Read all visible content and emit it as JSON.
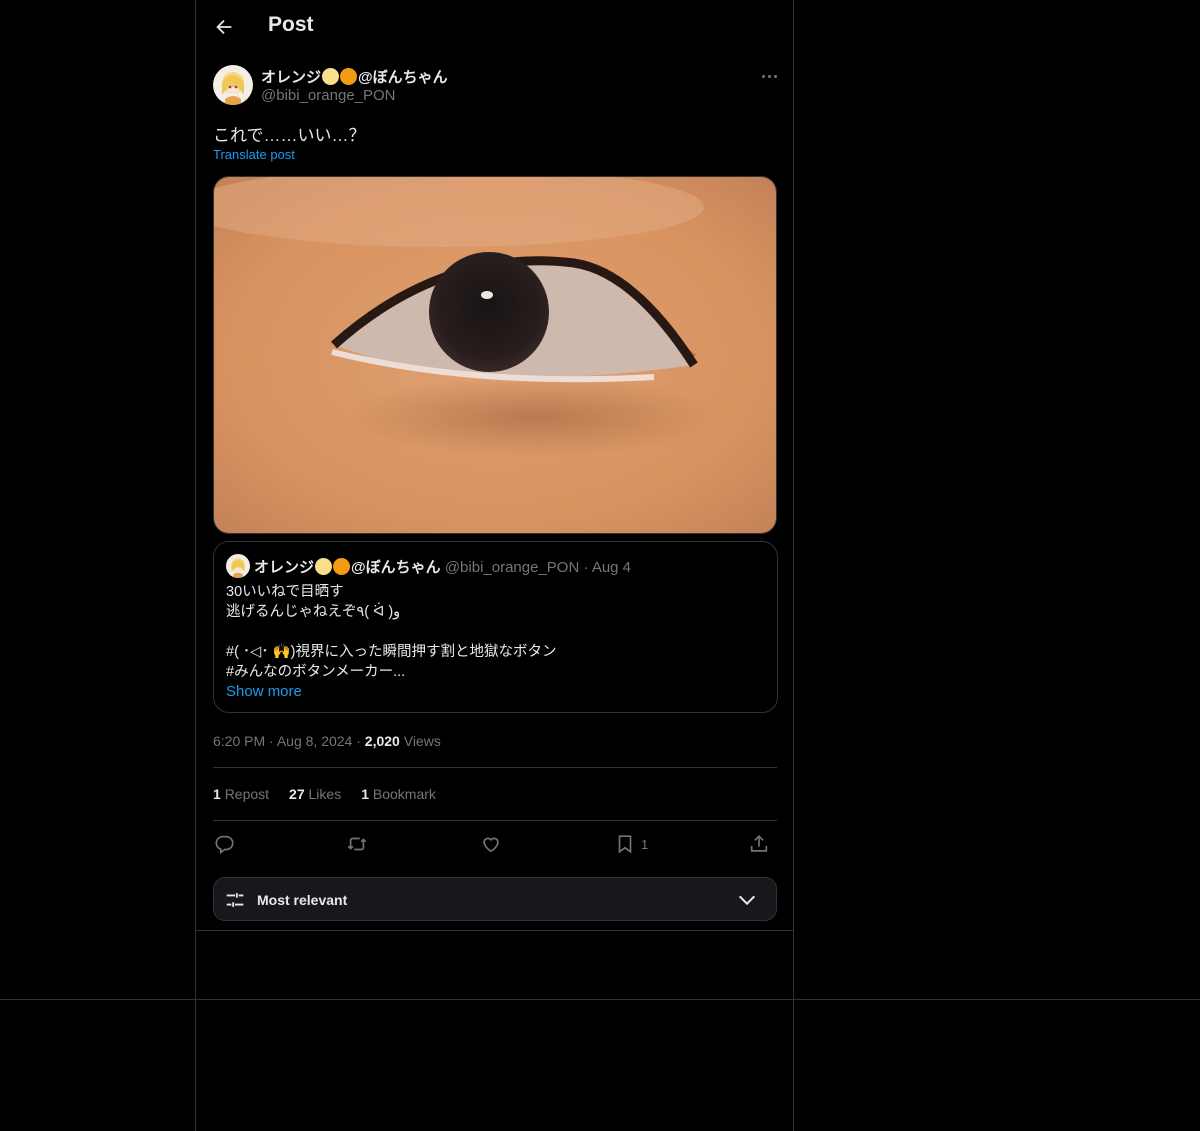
{
  "header": {
    "title": "Post"
  },
  "post": {
    "author_name": "オレンジ",
    "author_suffix": "@ぼんちゃん",
    "handle": "@bibi_orange_PON",
    "text": "これで……いい…？",
    "translate_label": "Translate post",
    "image_description_icon": "eye-photo",
    "time": "6:20 PM",
    "date": "Aug 8, 2024",
    "views_count": "2,020",
    "views_label": "Views",
    "reposts_count": "1",
    "reposts_label": "Repost",
    "likes_count": "27",
    "likes_label": "Likes",
    "bookmarks_count": "1",
    "bookmarks_label": "Bookmark",
    "bookmark_action_count": "1",
    "separator": "·"
  },
  "quote": {
    "author_name": "オレンジ",
    "author_suffix": "@ぼんちゃん",
    "handle": "@bibi_orange_PON",
    "date": "Aug 4",
    "lines": [
      "30いいねで目晒す",
      "逃げるんじゃねえぞ٩( ᐛ )و",
      "",
      "#( ･◁･ 🙌)視界に入った瞬間押す割と地獄なボタン",
      "#みんなのボタンメーカー..."
    ],
    "show_more": "Show more"
  },
  "sort": {
    "label": "Most relevant"
  },
  "colors": {
    "accent": "#1d9bf0",
    "border": "#2f3336",
    "muted": "#71767b",
    "text": "#e7e9ea",
    "background": "#000000"
  }
}
